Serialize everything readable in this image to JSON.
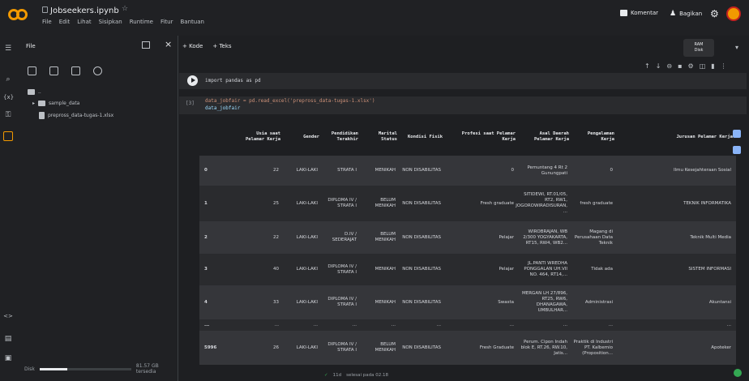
{
  "header": {
    "notebook_title": "Jobseekers.ipynb",
    "star_icon": "star-icon",
    "menu": [
      "File",
      "Edit",
      "Lihat",
      "Sisipkan",
      "Runtime",
      "Fitur",
      "Bantuan"
    ],
    "comment_label": "Komentar",
    "share_label": "Bagikan",
    "avatar_color": "#f29900"
  },
  "rail": {
    "icons": [
      "menu-icon",
      "search-icon",
      "variables-icon",
      "secrets-icon",
      "files-icon",
      "code-icon",
      "terminal-icon",
      "console-icon"
    ]
  },
  "files_panel": {
    "title": "File",
    "tree": [
      {
        "name": "..",
        "type": "folder"
      },
      {
        "name": "sample_data",
        "type": "folder"
      },
      {
        "name": "prepross_data-tugas-1.xlsx",
        "type": "file"
      }
    ],
    "disk_label": "Disk",
    "disk_usage": "81.57 GB tersedia",
    "disk_fraction": 0.3
  },
  "main": {
    "insert_code": "+ Kode",
    "insert_text": "+ Teks",
    "ram_label": "RAM",
    "disk_short": "Disk",
    "cell1_code": "import pandas as pd",
    "cell2_exec": "[3]",
    "cell2_line1": "data_jobfair = pd.read_excel('prepross_data-tugas-1.xlsx')",
    "cell2_line2": "data_jobfair"
  },
  "dataframe": {
    "columns": [
      "Usia saat Pelamar Kerja",
      "Gender",
      "Pendidikan Terakhir",
      "Marital Status",
      "Kondisi Fisik",
      "Profesi saat Pelamar Kerja",
      "Asal Daerah Pelamar Kerja",
      "Pengalaman Kerja",
      "Jurusan Pelamar Kerja"
    ],
    "rows": [
      {
        "idx": "0",
        "cells": [
          "22",
          "LAKI-LAKI",
          "STRATA I",
          "MENIKAH",
          "NON DISABILITAS",
          "0",
          "Pemuntang 4 Rt 2 Gunungpati",
          "0",
          "Ilmu Kesejahteraan Sosial"
        ]
      },
      {
        "idx": "1",
        "cells": [
          "25",
          "LAKI-LAKI",
          "DIPLOMA IV / STRATA I",
          "BELUM MENIKAH",
          "NON DISABILITAS",
          "Fresh graduate",
          "SITIDEWI, RT.01/05, RT2, RW1, JOGOROWIRADISURAN, ...",
          "fresh graduate",
          "TEKNIK INFORMATIKA"
        ]
      },
      {
        "idx": "2",
        "cells": [
          "22",
          "LAKI-LAKI",
          "D.IV / SEDERAJAT",
          "BELUM MENIKAH",
          "NON DISABILITAS",
          "Pelajar",
          "WIROBRAJAN, WB 2/300 YOGYAKARTA, RT15, RW4, WB2...",
          "Magang di Perusahaan Data Teknik",
          "Teknik Multi Media"
        ]
      },
      {
        "idx": "3",
        "cells": [
          "40",
          "LAKI-LAKI",
          "DIPLOMA IV / STRATA I",
          "MENIKAH",
          "NON DISABILITAS",
          "Pelajar",
          "JL.PANTI WREDHA PONGGALAN UH.VII NO. 464, RT14,...",
          "Tidak ada",
          "SISTEM INFORMASI"
        ]
      },
      {
        "idx": "4",
        "cells": [
          "33",
          "LAKI-LAKI",
          "DIPLOMA IV / STRATA I",
          "MENIKAH",
          "NON DISABILITAS",
          "Swasta",
          "MERGAN LH 27/896, RT25, RW6, DHANAGAWA, UMBULHAR...",
          "Administrasi",
          "Akuntansi"
        ]
      },
      {
        "idx": "...",
        "cells": [
          "...",
          "...",
          "...",
          "...",
          "...",
          "...",
          "...",
          "...",
          "..."
        ]
      },
      {
        "idx": "5996",
        "cells": [
          "26",
          "LAKI-LAKI",
          "DIPLOMA IV / STRATA I",
          "BELUM MENIKAH",
          "NON DISABILITAS",
          "Fresh Graduate",
          "Perum. Cipon Indah blok E, RT.26, RW.10, Jatis...",
          "Praktik di Industri PT. Kalbemio (Proposition...",
          "Apoteker"
        ]
      }
    ]
  },
  "status": {
    "exec_time": "11d",
    "complete_label": "selesai pada 02.18"
  }
}
